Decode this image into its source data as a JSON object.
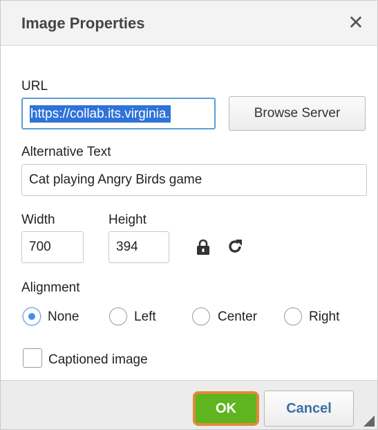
{
  "dialog": {
    "title": "Image Properties",
    "close_icon": "close-icon"
  },
  "url": {
    "label": "URL",
    "value": "https://collab.its.virginia.",
    "browse_label": "Browse Server"
  },
  "alt": {
    "label": "Alternative Text",
    "value": "Cat playing Angry Birds game"
  },
  "size": {
    "width_label": "Width",
    "width_value": "700",
    "height_label": "Height",
    "height_value": "394",
    "lock_icon": "lock-icon",
    "reset_icon": "reset-size-icon"
  },
  "alignment": {
    "label": "Alignment",
    "options": [
      "None",
      "Left",
      "Center",
      "Right"
    ],
    "selected": "None"
  },
  "caption": {
    "label": "Captioned image",
    "checked": false
  },
  "footer": {
    "ok_label": "OK",
    "cancel_label": "Cancel"
  },
  "colors": {
    "ok_button": "#5fb51f",
    "ok_highlight_ring": "#e08a3a",
    "cancel_text": "#3a6ea5",
    "selection_highlight": "#2f73d8"
  }
}
